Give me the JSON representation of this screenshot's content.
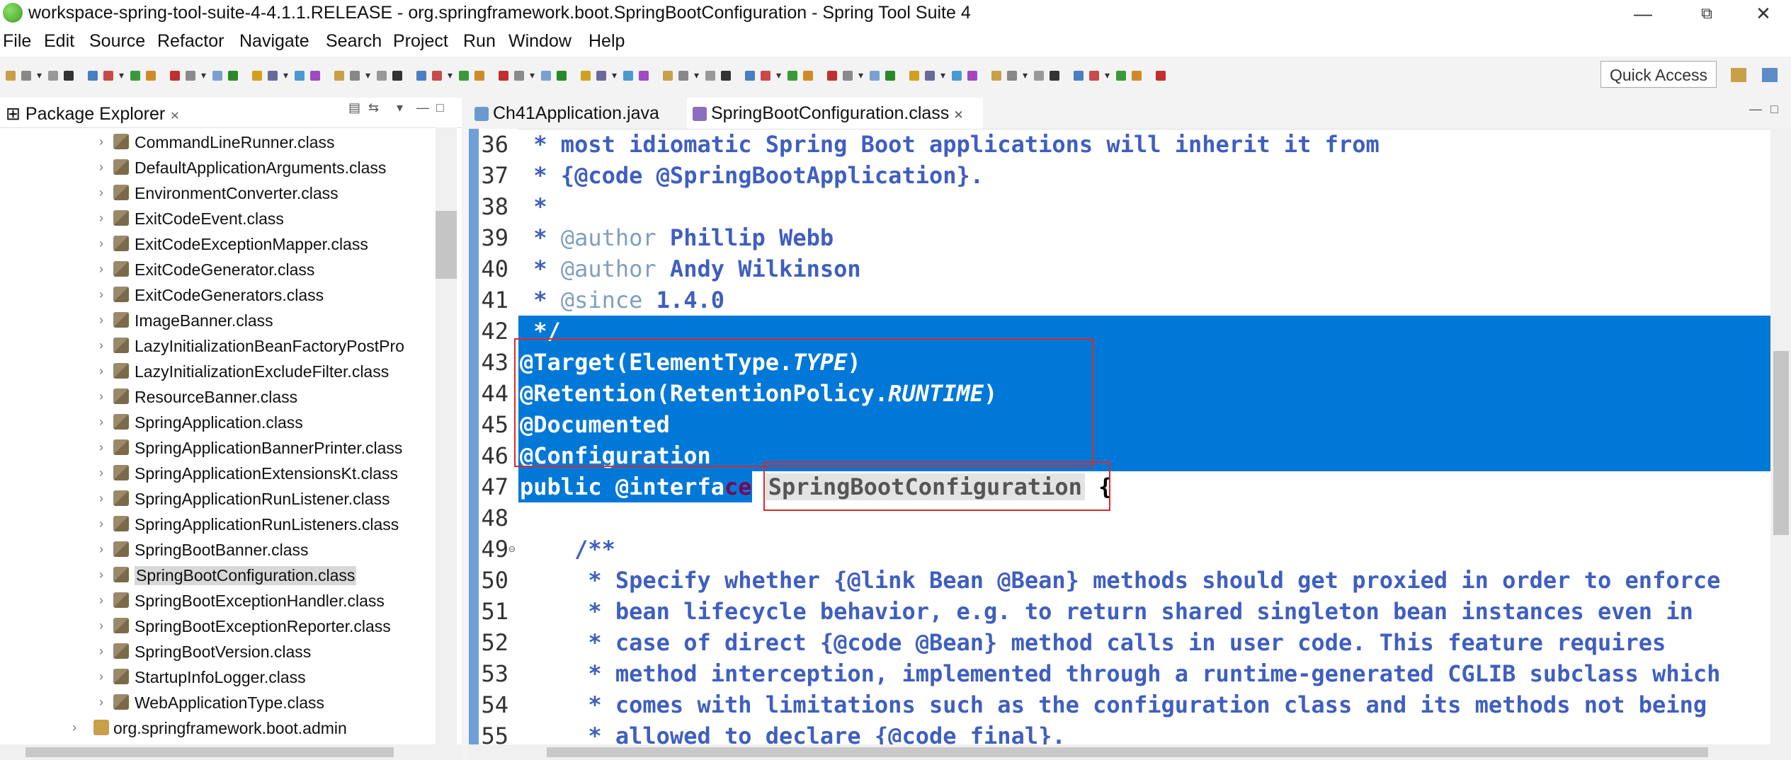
{
  "window": {
    "title": "workspace-spring-tool-suite-4-4.1.1.RELEASE - org.springframework.boot.SpringBootConfiguration - Spring Tool Suite 4",
    "minimize": "—",
    "restore": "⧉",
    "close": "✕"
  },
  "menu": [
    "File",
    "Edit",
    "Source",
    "Refactor",
    "Navigate",
    "Search",
    "Project",
    "Run",
    "Window",
    "Help"
  ],
  "toolbar": {
    "quick_access": "Quick Access"
  },
  "package_explorer": {
    "title": "Package Explorer",
    "items": [
      {
        "label": "CommandLineRunner.class"
      },
      {
        "label": "DefaultApplicationArguments.class"
      },
      {
        "label": "EnvironmentConverter.class"
      },
      {
        "label": "ExitCodeEvent.class"
      },
      {
        "label": "ExitCodeExceptionMapper.class"
      },
      {
        "label": "ExitCodeGenerator.class"
      },
      {
        "label": "ExitCodeGenerators.class"
      },
      {
        "label": "ImageBanner.class"
      },
      {
        "label": "LazyInitializationBeanFactoryPostPro"
      },
      {
        "label": "LazyInitializationExcludeFilter.class"
      },
      {
        "label": "ResourceBanner.class"
      },
      {
        "label": "SpringApplication.class"
      },
      {
        "label": "SpringApplicationBannerPrinter.class"
      },
      {
        "label": "SpringApplicationExtensionsKt.class"
      },
      {
        "label": "SpringApplicationRunListener.class"
      },
      {
        "label": "SpringApplicationRunListeners.class"
      },
      {
        "label": "SpringBootBanner.class"
      },
      {
        "label": "SpringBootConfiguration.class",
        "selected": true
      },
      {
        "label": "SpringBootExceptionHandler.class"
      },
      {
        "label": "SpringBootExceptionReporter.class"
      },
      {
        "label": "SpringBootVersion.class"
      },
      {
        "label": "StartupInfoLogger.class"
      },
      {
        "label": "WebApplicationType.class"
      },
      {
        "label": "org.springframework.boot.admin",
        "type": "package"
      }
    ]
  },
  "editor": {
    "tabs": [
      {
        "label": "Ch41Application.java",
        "active": false
      },
      {
        "label": "SpringBootConfiguration.class",
        "active": true
      }
    ],
    "lines": [
      {
        "n": "36",
        "parts": [
          {
            "t": " * most idiomatic Spring Boot applications will inherit it from",
            "c": "comment"
          }
        ]
      },
      {
        "n": "37",
        "parts": [
          {
            "t": " * {@code @SpringBootApplication}.",
            "c": "comment"
          }
        ]
      },
      {
        "n": "38",
        "parts": [
          {
            "t": " *",
            "c": "comment"
          }
        ]
      },
      {
        "n": "39",
        "parts": [
          {
            "t": " * ",
            "c": "comment"
          },
          {
            "t": "@author",
            "c": "tag"
          },
          {
            "t": " Phillip Webb",
            "c": "comment"
          }
        ]
      },
      {
        "n": "40",
        "parts": [
          {
            "t": " * ",
            "c": "comment"
          },
          {
            "t": "@author",
            "c": "tag"
          },
          {
            "t": " Andy Wilkinson",
            "c": "comment"
          }
        ]
      },
      {
        "n": "41",
        "parts": [
          {
            "t": " * ",
            "c": "comment"
          },
          {
            "t": "@since",
            "c": "tag"
          },
          {
            "t": " 1.4.0",
            "c": "comment"
          }
        ]
      },
      {
        "n": "42",
        "parts": [
          {
            "t": " */",
            "c": "wh"
          }
        ]
      },
      {
        "n": "43",
        "parts": [
          {
            "t": "@Target(ElementType.",
            "c": "wh"
          },
          {
            "t": "TYPE",
            "c": "wh it"
          },
          {
            "t": ")",
            "c": "wh"
          }
        ]
      },
      {
        "n": "44",
        "parts": [
          {
            "t": "@Retention(RetentionPolicy.",
            "c": "wh"
          },
          {
            "t": "RUNTIME",
            "c": "wh it"
          },
          {
            "t": ")",
            "c": "wh"
          }
        ]
      },
      {
        "n": "45",
        "parts": [
          {
            "t": "@Documented",
            "c": "wh"
          }
        ]
      },
      {
        "n": "46",
        "parts": [
          {
            "t": "@Configuration",
            "c": "wh"
          }
        ]
      },
      {
        "n": "47",
        "parts": [
          {
            "t": "public @interfa",
            "c": "wh"
          },
          {
            "t": "ce ",
            "c": "kw"
          },
          {
            "t": "SpringBootConfiguration",
            "c": "hl"
          },
          {
            "t": " {",
            "c": "plain"
          }
        ]
      },
      {
        "n": "48",
        "parts": []
      },
      {
        "n": "49",
        "parts": [
          {
            "t": "    /**",
            "c": "comment"
          }
        ],
        "fold": true
      },
      {
        "n": "50",
        "parts": [
          {
            "t": "     * Specify whether {@link Bean @Bean} methods should get proxied in order to enforce",
            "c": "comment"
          }
        ]
      },
      {
        "n": "51",
        "parts": [
          {
            "t": "     * bean lifecycle behavior, e.g. to return shared singleton bean instances even in",
            "c": "comment"
          }
        ]
      },
      {
        "n": "52",
        "parts": [
          {
            "t": "     * case of direct {@code @Bean} method calls in user code. This feature requires",
            "c": "comment"
          }
        ]
      },
      {
        "n": "53",
        "parts": [
          {
            "t": "     * method interception, implemented through a runtime-generated CGLIB subclass which",
            "c": "comment"
          }
        ]
      },
      {
        "n": "54",
        "parts": [
          {
            "t": "     * comes with limitations such as the configuration class and its methods not being",
            "c": "comment"
          }
        ]
      },
      {
        "n": "55",
        "parts": [
          {
            "t": "     * allowed to declare {@code final}.",
            "c": "comment"
          }
        ]
      }
    ]
  },
  "colors": {
    "selection": "#0078d7",
    "comment": "#3f5fbf",
    "keyword": "#7f0055",
    "highlight_box": "#e02828",
    "ruler": "#6f9fd8"
  }
}
